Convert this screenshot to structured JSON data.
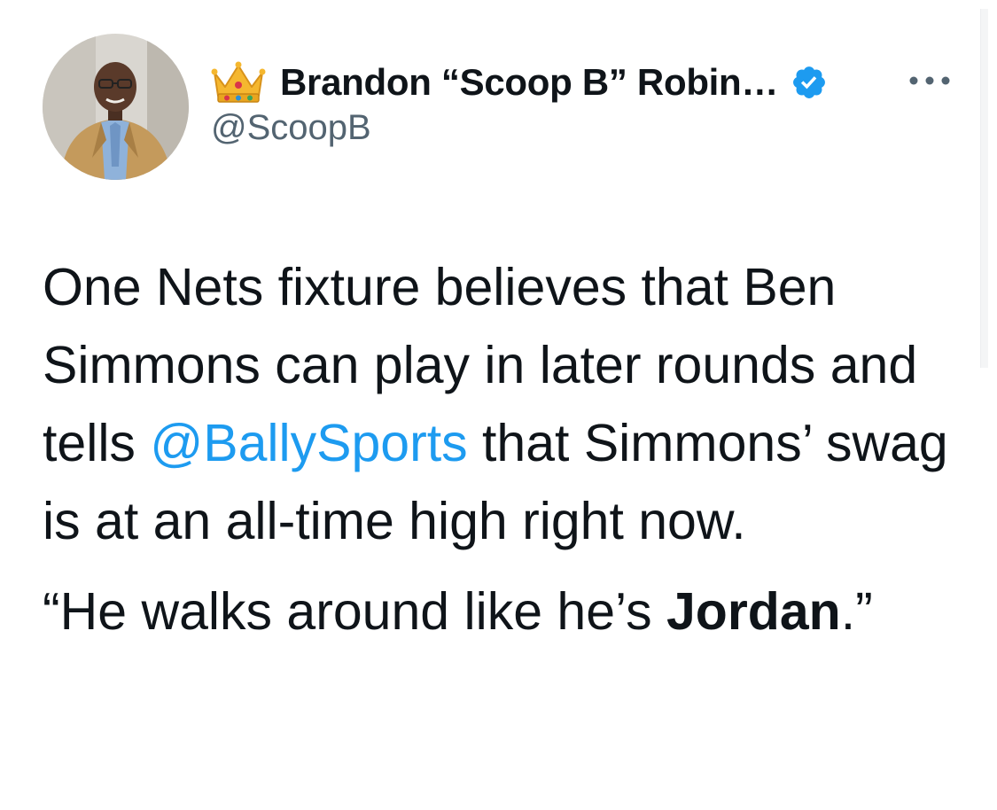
{
  "profile": {
    "display_name": "Brandon “Scoop B” Robin…",
    "handle": "@ScoopB",
    "name_emoji_icon": "crown-icon",
    "verified_icon": "verified-badge-icon",
    "avatar_alt": "profile photo"
  },
  "menu": {
    "more_icon": "more-options-icon"
  },
  "tweet": {
    "para1_part1": "One Nets fixture believes that Ben Simmons can play in later rounds and tells ",
    "mention": "@BallySports",
    "para1_part2": " that Simmons’ swag is at an all-time high right now.",
    "quote_part1": "“He walks around like he’s ",
    "quote_bold": "Jordan",
    "quote_part2": ".”"
  },
  "colors": {
    "text": "#0f1419",
    "secondary": "#536471",
    "link": "#1d9bf0",
    "verified": "#1d9bf0"
  }
}
